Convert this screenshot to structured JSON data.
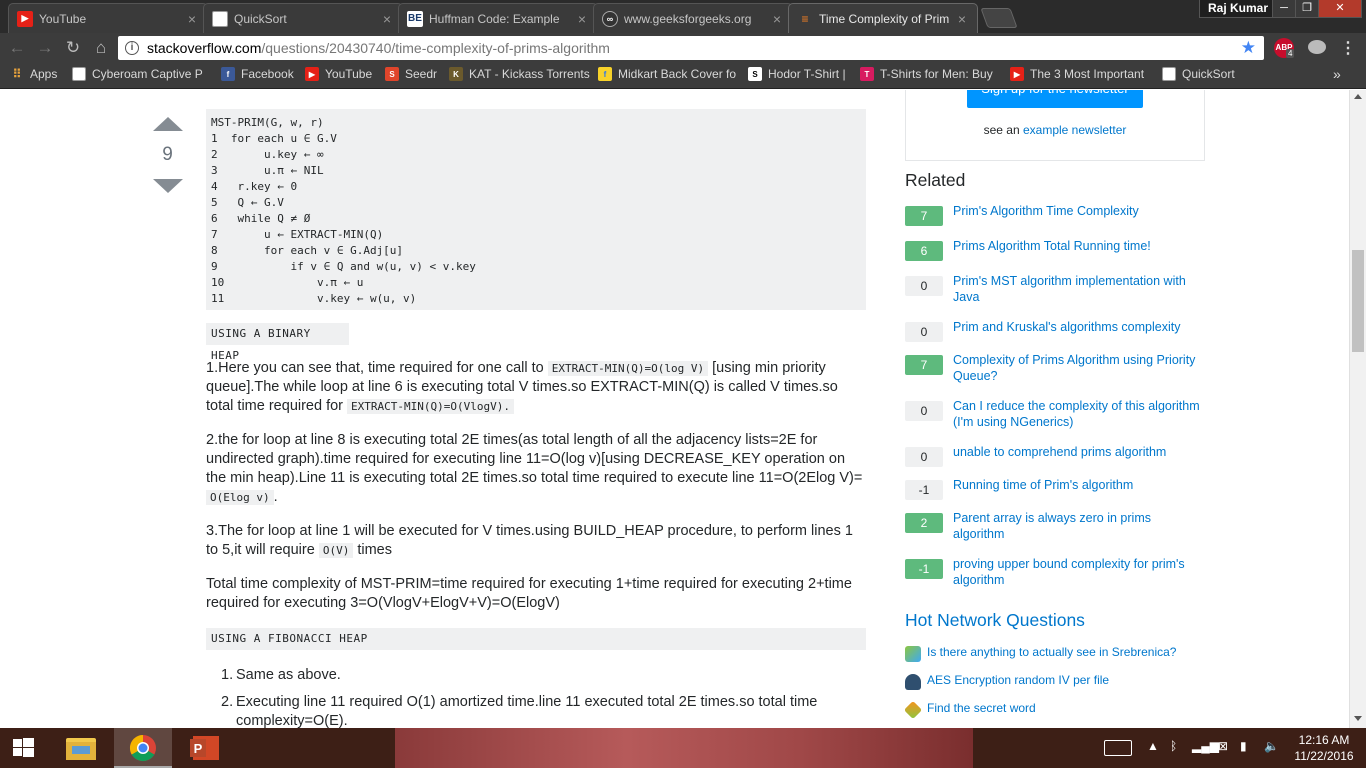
{
  "browser": {
    "tabs": [
      {
        "label": "YouTube",
        "icon": "youtube-icon"
      },
      {
        "label": "QuickSort",
        "icon": "page-icon"
      },
      {
        "label": "Huffman Code: Example",
        "icon": "be-icon"
      },
      {
        "label": "www.geeksforgeeks.org",
        "icon": "geeksforgeeks-icon"
      },
      {
        "label": "Time Complexity of Prim",
        "icon": "stackoverflow-icon"
      }
    ],
    "profile_name": "Raj Kumar",
    "url_host": "stackoverflow.com",
    "url_path": "/questions/20430740/time-complexity-of-prims-algorithm",
    "abp_label": "ABP",
    "abp_count": "4",
    "bookmarks": [
      {
        "label": "Apps",
        "icon": "apps-grid-icon"
      },
      {
        "label": "Cyberoam Captive P",
        "icon": "page-icon"
      },
      {
        "label": "Facebook",
        "icon": "facebook-icon"
      },
      {
        "label": "YouTube",
        "icon": "youtube-icon"
      },
      {
        "label": "Seedr",
        "icon": "seedr-icon"
      },
      {
        "label": "KAT - Kickass Torrents",
        "icon": "kat-icon"
      },
      {
        "label": "Midkart Back Cover fo",
        "icon": "flipkart-icon"
      },
      {
        "label": "Hodor T-Shirt |",
        "icon": "hodor-icon"
      },
      {
        "label": "T-Shirts for Men: Buy",
        "icon": "tshirt-icon"
      },
      {
        "label": "The 3 Most Important",
        "icon": "youtube-icon"
      },
      {
        "label": "QuickSort",
        "icon": "page-icon"
      }
    ]
  },
  "answer": {
    "votes": "9",
    "algorithm_lines": [
      "MST-PRIM(G, w, r)",
      "1  for each u ∈ G.V",
      "2       u.key ← ∞",
      "3       u.π ← NIL",
      "4   r.key ← 0",
      "5   Q ← G.V",
      "6   while Q ≠ Ø",
      "7       u ← EXTRACT-MIN(Q)",
      "8       for each v ∈ G.Adj[u]",
      "9           if v ∈ Q and w(u, v) < v.key",
      "10              v.π ← u",
      "11              v.key ← w(u, v)"
    ],
    "binary_heap_label": "USING A BINARY HEAP",
    "p1": {
      "a": "1.Here you can see that, time required for one call to ",
      "code1": "EXTRACT-MIN(Q)=O(log V)",
      "b": " [using min priority queue].The while loop at line 6 is executing total V times.so EXTRACT-MIN(Q) is called V times.so total time required for ",
      "code2": "EXTRACT-MIN(Q)=O(VlogV)."
    },
    "p2": {
      "a": "2.the for loop at line 8 is executing total 2E times(as total length of all the adjacency lists=2E for undirected graph).time required for executing line 11=O(log v)[using DECREASE_KEY operation on the min heap).Line 11 is executing total 2E times.so total time required to execute line 11=O(2Elog V)= ",
      "code": "O(Elog v)",
      "b": "."
    },
    "p3": {
      "a": "3.The for loop at line 1 will be executed for V times.using BUILD_HEAP procedure, to perform lines 1 to 5,it will require ",
      "code": "O(V)",
      "b": " times"
    },
    "p4": "Total time complexity of MST-PRIM=time required for executing 1+time required for executing 2+time required for executing 3=O(VlogV+ElogV+V)=O(ElogV)",
    "fib_heap_label": "USING A FIBONACCI HEAP",
    "fib_list": [
      {
        "num": "1.",
        "text": "Same as above."
      },
      {
        "num": "2.",
        "text": "Executing line 11 required O(1) amortized time.line 11 executed total 2E times.so total time complexity=O(E)."
      }
    ]
  },
  "sidebar": {
    "signup_button": "Sign up for the newsletter",
    "newsletter_prefix": "see an ",
    "newsletter_link": "example newsletter",
    "related_title": "Related",
    "related": [
      {
        "score": "7",
        "title": "Prim's Algorithm Time Complexity"
      },
      {
        "score": "6",
        "title": "Prims Algorithm Total Running time!"
      },
      {
        "score": "0",
        "title": "Prim's MST algorithm implementation with Java"
      },
      {
        "score": "0",
        "title": "Prim and Kruskal's algorithms complexity"
      },
      {
        "score": "7",
        "title": "Complexity of Prims Algorithm using Priority Queue?"
      },
      {
        "score": "0",
        "title": "Can I reduce the complexity of this algorithm (I'm using NGenerics)"
      },
      {
        "score": "0",
        "title": "unable to comprehend prims algorithm"
      },
      {
        "score": "-1",
        "title": "Running time of Prim's algorithm"
      },
      {
        "score": "2",
        "title": "Parent array is always zero in prims algorithm"
      },
      {
        "score": "-1",
        "title": "proving upper bound complexity for prim's algorithm"
      }
    ],
    "hnq_title": "Hot Network Questions",
    "hnq": [
      {
        "icon": "travel-site-icon",
        "title": "Is there anything to actually see in Srebrenica?"
      },
      {
        "icon": "crypto-site-icon",
        "title": "AES Encryption random IV per file"
      },
      {
        "icon": "puzzling-site-icon",
        "title": "Find the secret word"
      }
    ]
  },
  "taskbar": {
    "time": "12:16 AM",
    "date": "11/22/2016"
  },
  "colors": {
    "so_link": "#0077cc",
    "vote_positive": "#5eba7d",
    "newsletter_button": "#0095ff",
    "chrome_dark": "#3c3c3c",
    "abp_red": "#c70d2c"
  }
}
